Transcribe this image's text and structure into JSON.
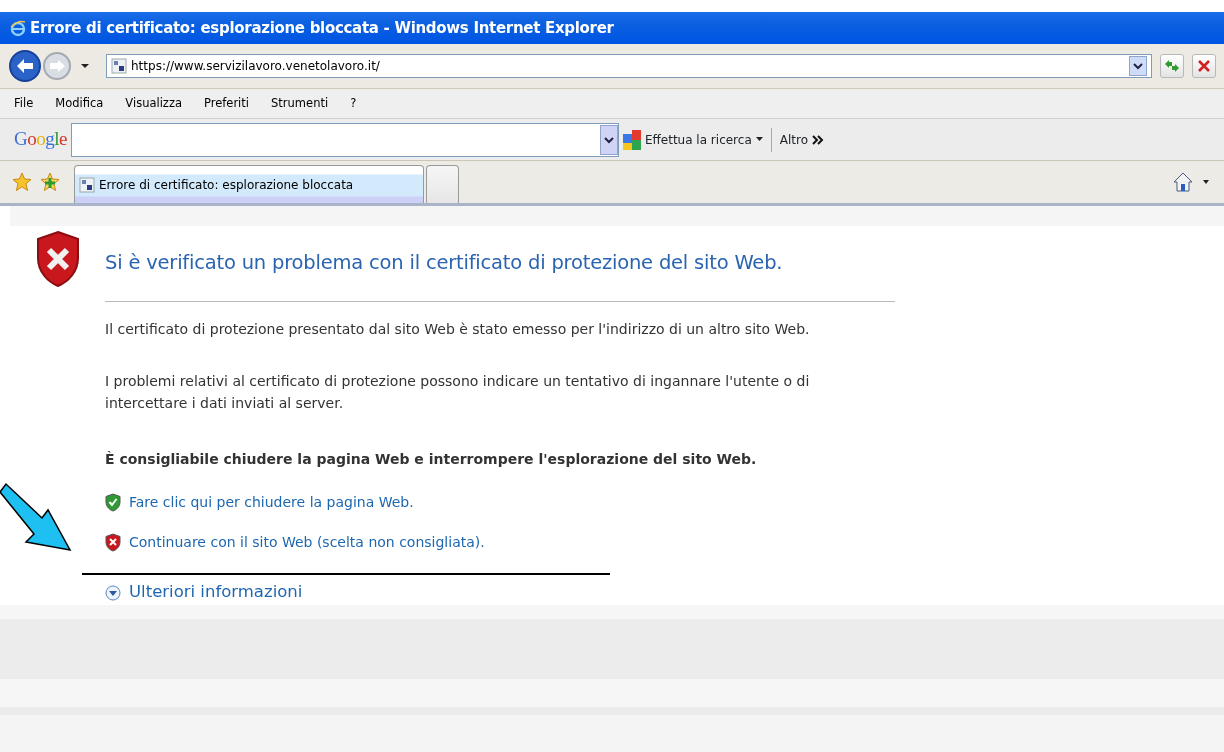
{
  "window": {
    "title": "Errore di certificato: esplorazione bloccata - Windows Internet Explorer"
  },
  "address_bar": {
    "url": "https://www.servizilavoro.venetolavoro.it/"
  },
  "menu": [
    "File",
    "Modifica",
    "Visualizza",
    "Preferiti",
    "Strumenti",
    "?"
  ],
  "google_toolbar": {
    "logo": "Google",
    "search_button": "Effettua la ricerca",
    "more": "Altro"
  },
  "tabs": [
    {
      "label": "Errore di certificato: esplorazione bloccata",
      "selected": true
    },
    {
      "selected": false
    }
  ],
  "content": {
    "heading": "Si è verificato un problema con il certificato di protezione del sito Web.",
    "paragraphs": [
      "Il certificato di protezione presentato dal sito Web è stato emesso per l'indirizzo di un altro sito Web.",
      "I problemi relativi al certificato di protezione possono indicare un tentativo di ingannare l'utente o di intercettare i dati inviati al server."
    ],
    "recommendation": "È consigliabile chiudere la pagina Web e interrompere l'esplorazione del sito Web.",
    "links": [
      {
        "label": "Fare clic qui per chiudere la pagina Web.",
        "kind": "safe"
      },
      {
        "label": "Continuare con il sito Web (scelta non consigliata).",
        "kind": "unsafe"
      }
    ],
    "more_info": {
      "label": "Ulteriori informazioni",
      "expanded": false
    }
  }
}
